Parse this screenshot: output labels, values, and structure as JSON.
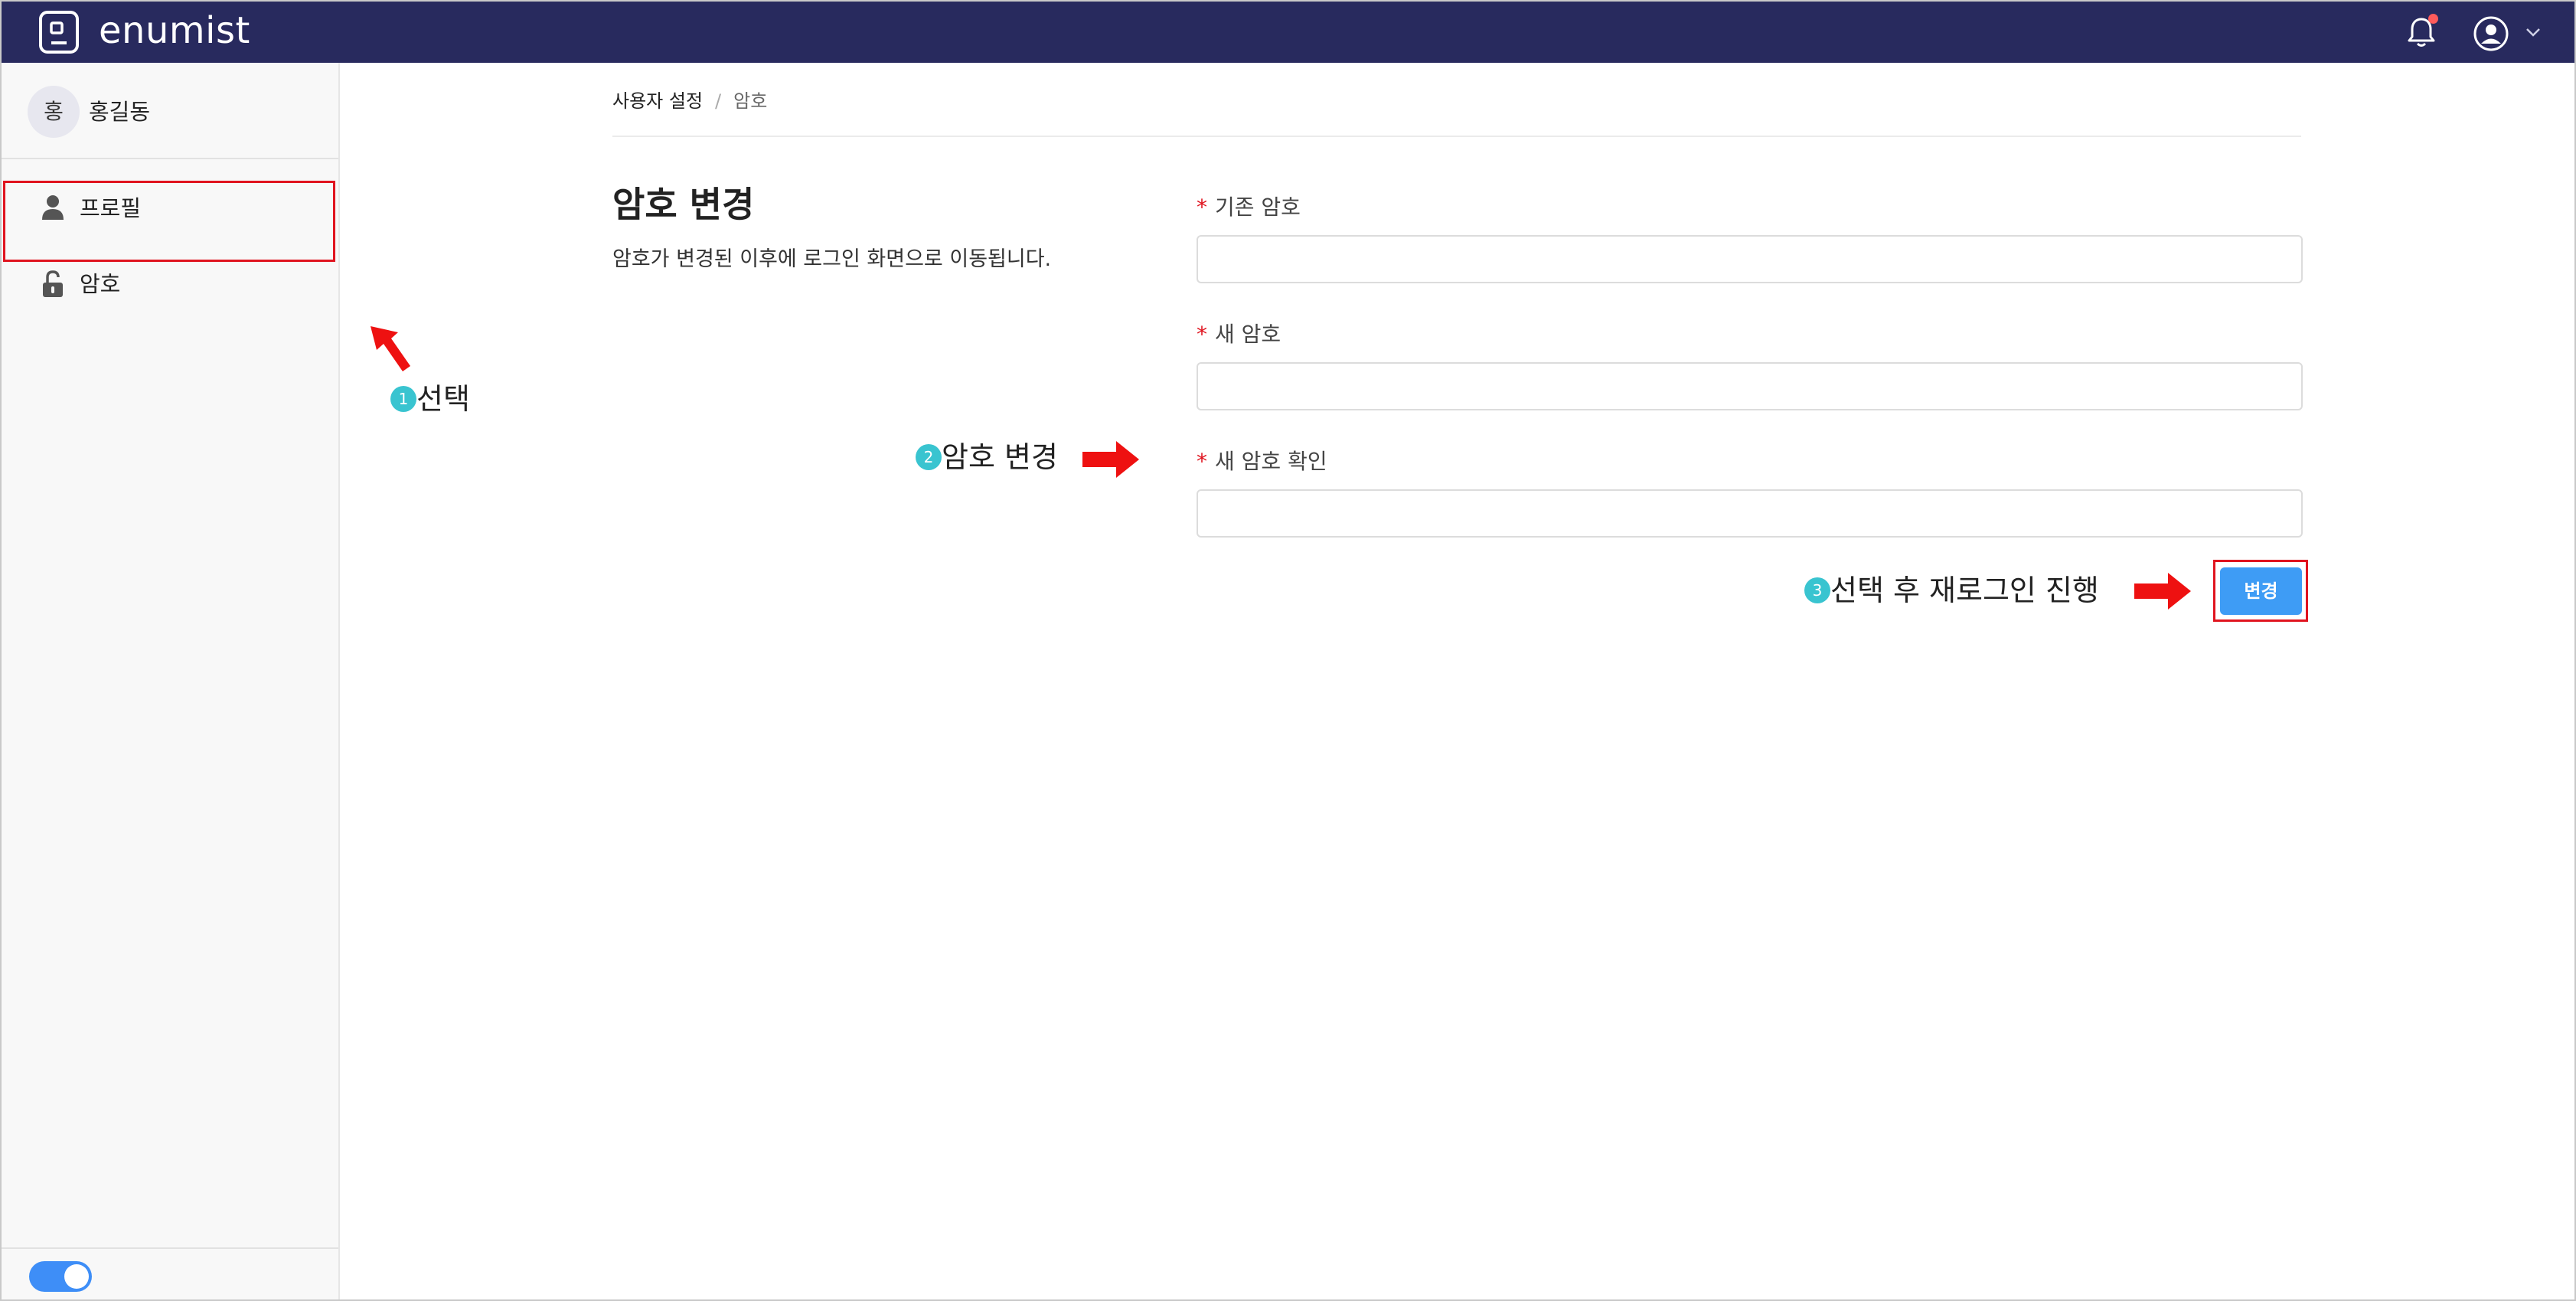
{
  "app": {
    "brand": "enumist"
  },
  "header": {
    "has_notification": true
  },
  "sidebar": {
    "user": {
      "avatar_initial": "홍",
      "name": "홍길동"
    },
    "items": [
      {
        "label": "프로필",
        "icon": "person-icon"
      },
      {
        "label": "암호",
        "icon": "unlock-icon",
        "selected": true
      }
    ],
    "theme_toggle_on": true
  },
  "breadcrumb": {
    "root": "사용자 설정",
    "separator": "/",
    "current": "암호"
  },
  "section": {
    "title": "암호 변경",
    "description": "암호가 변경된 이후에 로그인 화면으로 이동됩니다."
  },
  "form": {
    "required_mark": "*",
    "current_password": {
      "label": "기존 암호",
      "value": ""
    },
    "new_password": {
      "label": "새 암호",
      "value": ""
    },
    "confirm_password": {
      "label": "새 암호 확인",
      "value": ""
    },
    "submit_label": "변경"
  },
  "annotations": {
    "step1": {
      "num": "1",
      "text": "선택"
    },
    "step2": {
      "num": "2",
      "text": "암호 변경"
    },
    "step3": {
      "num": "3",
      "text": "선택 후 재로그인 진행"
    }
  },
  "colors": {
    "topbar": "#282a5e",
    "accent": "#3e9cf5",
    "highlight": "#e0141f",
    "step_badge": "#39c4d0"
  }
}
